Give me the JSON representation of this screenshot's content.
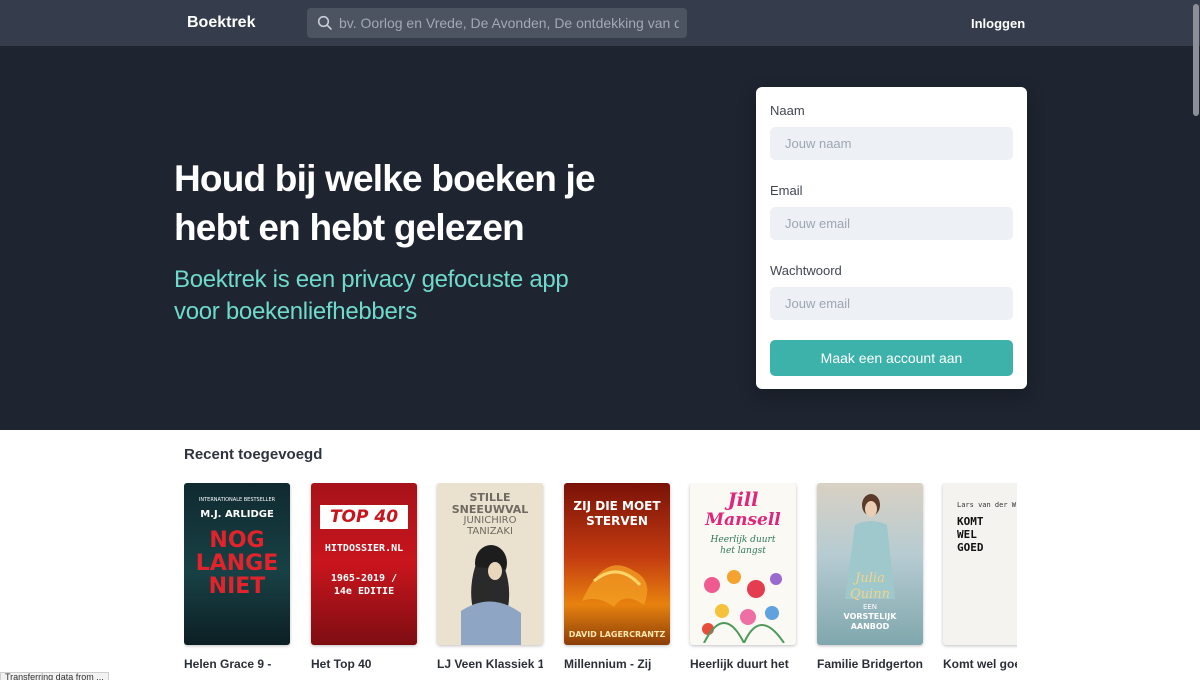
{
  "header": {
    "brand": "Boektrek",
    "search_placeholder": "bv. Oorlog en Vrede, De Avonden, De ontdekking van d",
    "login_label": "Inloggen"
  },
  "hero": {
    "title": "Houd bij welke boeken je hebt en hebt gelezen",
    "subtitle": "Boektrek is een privacy gefocuste app voor boekenliefhebbers"
  },
  "signup_form": {
    "name_label": "Naam",
    "name_placeholder": "Jouw naam",
    "email_label": "Email",
    "email_placeholder": "Jouw email",
    "password_label": "Wachtwoord",
    "password_placeholder": "Jouw email",
    "submit_label": "Maak een account aan"
  },
  "recent": {
    "heading": "Recent toegevoegd",
    "books": [
      {
        "title": "Helen Grace 9 -",
        "cover_lines": [
          "INTERNATIONALE BESTSELLER",
          "M.J. ARLIDGE",
          "NOG",
          "LANGE",
          "NIET"
        ]
      },
      {
        "title": "Het Top 40",
        "cover_lines": [
          "TOP 40",
          "HITDOSSIER.NL",
          "1965-2019 /",
          "14e EDITIE"
        ]
      },
      {
        "title": "LJ Veen Klassiek 1",
        "cover_lines": [
          "STILLE",
          "SNEEUWVAL",
          "JUNICHIRO",
          "TANIZAKI"
        ]
      },
      {
        "title": "Millennium - Zij",
        "cover_lines": [
          "ZIJ DIE MOET",
          "STERVEN",
          "DAVID LAGERCRANTZ"
        ]
      },
      {
        "title": "Heerlijk duurt het",
        "cover_lines": [
          "Jill",
          "Mansell",
          "Heerlijk duurt",
          "het langst"
        ]
      },
      {
        "title": "Familie Bridgerton",
        "cover_lines": [
          "Julia",
          "Quinn",
          "EEN",
          "VORSTELIJK",
          "AANBOD"
        ]
      },
      {
        "title": "Komt wel goe",
        "cover_lines": [
          "Lars van der W",
          "KOMT",
          "WEL",
          "GOED"
        ]
      }
    ]
  },
  "colors": {
    "topbar": "#353d4c",
    "hero_bg": "#1e2430",
    "accent_teal": "#3cb2aa",
    "subtitle_teal": "#6fd9cc"
  },
  "status_bar": "Transferring data from ..."
}
